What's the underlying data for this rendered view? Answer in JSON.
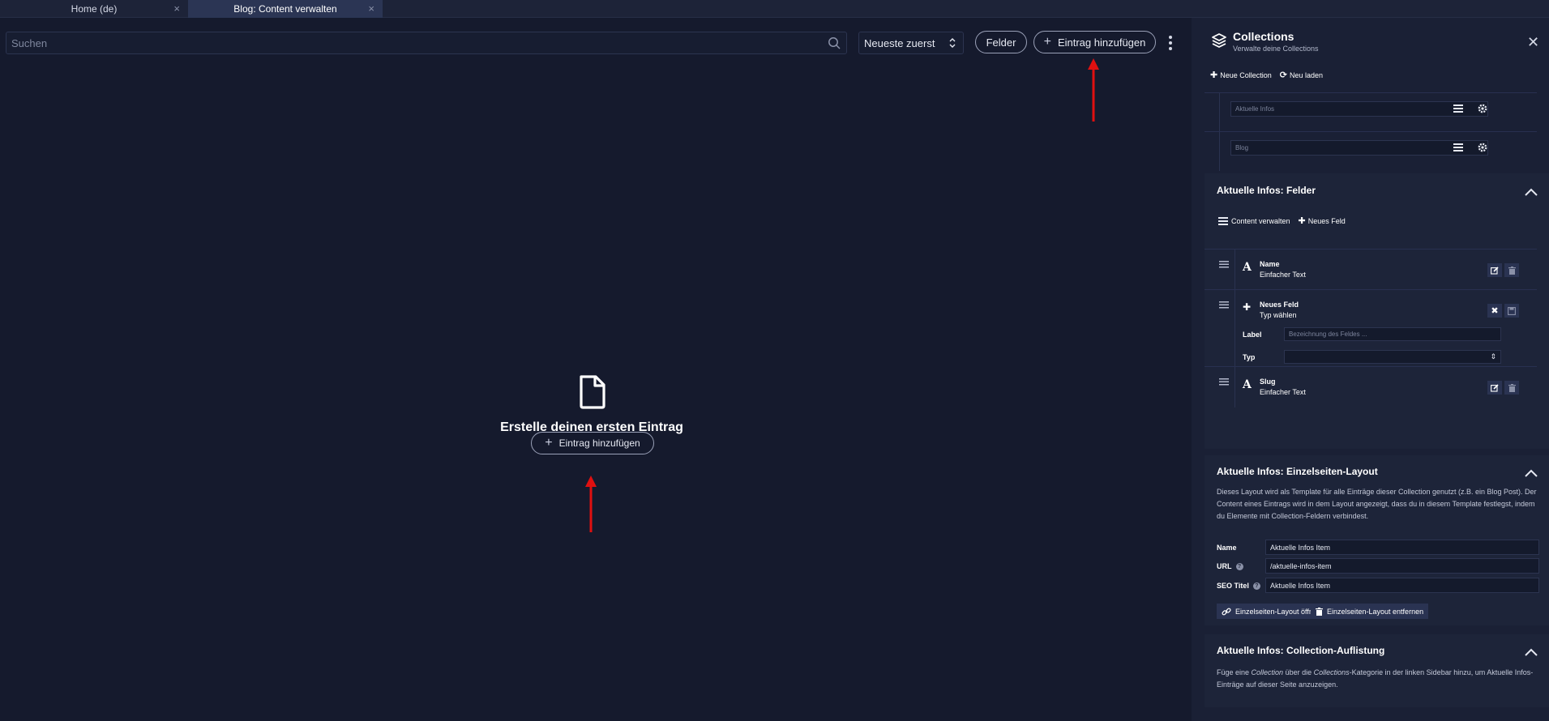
{
  "tabs": [
    {
      "label": "Home (de)",
      "active": false
    },
    {
      "label": "Blog: Content verwalten",
      "active": true
    }
  ],
  "toolbar": {
    "search_placeholder": "Suchen",
    "sort_value": "Neueste zuerst",
    "fields_label": "Felder",
    "add_entry_label": "Eintrag hinzufügen"
  },
  "empty_state": {
    "title": "Erstelle deinen ersten Eintrag",
    "add_label": "Eintrag hinzufügen"
  },
  "panel": {
    "title": "Collections",
    "subtitle": "Verwalte deine Collections",
    "new_collection": "Neue Collection",
    "reload": "Neu laden",
    "collections": [
      "Aktuelle Infos",
      "Blog"
    ],
    "fields_section": {
      "title": "Aktuelle Infos: Felder",
      "manage_content": "Content verwalten",
      "new_field": "Neues Feld",
      "fields": [
        {
          "name": "Name",
          "type": "Einfacher Text"
        },
        {
          "name": "Slug",
          "type": "Einfacher Text"
        }
      ],
      "new_field_form": {
        "title": "Neues Feld",
        "subtitle": "Typ wählen",
        "label_caption": "Label",
        "label_placeholder": "Bezeichnung des Feldes ...",
        "type_caption": "Typ",
        "type_value": ""
      }
    },
    "layout_section": {
      "title": "Aktuelle Infos: Einzelseiten-Layout",
      "description": "Dieses Layout wird als Template für alle Einträge dieser Collection genutzt (z.B. ein Blog Post). Der Content eines Eintrags wird in dem Layout angezeigt, dass du in diesem Template festlegst, indem du Elemente mit Collection-Feldern verbindest.",
      "name_label": "Name",
      "name_value": "Aktuelle Infos Item",
      "url_label": "URL",
      "url_value": "/aktuelle-infos-item",
      "seo_label": "SEO Titel",
      "seo_value": "Aktuelle Infos Item",
      "open_button": "Einzelseiten-Layout öffnen",
      "remove_button": "Einzelseiten-Layout entfernen"
    },
    "listing_section": {
      "title": "Aktuelle Infos: Collection-Auflistung",
      "desc_part1": "Füge eine ",
      "desc_em1": "Collection",
      "desc_part2": " über die ",
      "desc_em2": "Collections",
      "desc_part3": "-Kategorie in der linken Sidebar hinzu, um Aktuelle Infos-Einträge auf dieser Seite anzuzeigen."
    }
  },
  "colors": {
    "background": "#151a2d",
    "panel": "#1a2035",
    "annotation_arrow": "#e01010"
  }
}
